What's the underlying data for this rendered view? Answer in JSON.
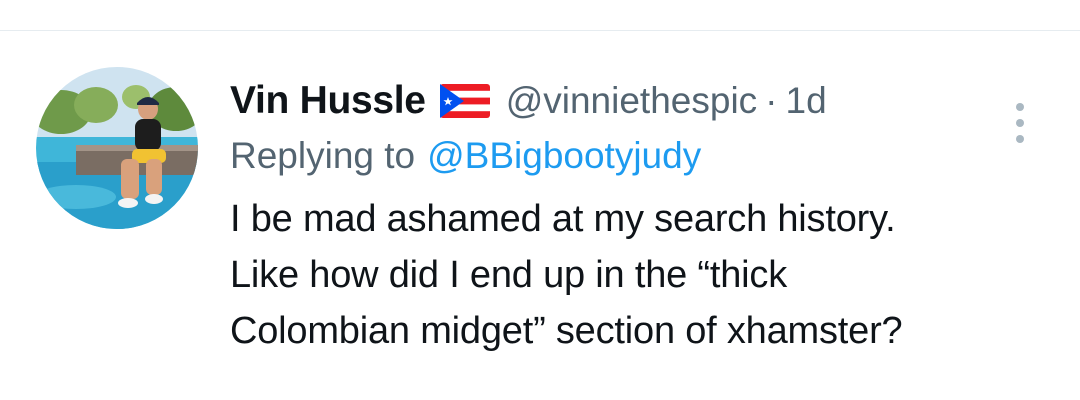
{
  "tweet": {
    "display_name": "Vin Hussle",
    "flag_icon": "puerto-rico-flag-icon",
    "handle": "@vinniethespic",
    "separator": "·",
    "time": "1d",
    "replying_prefix": "Replying to",
    "replying_to": "@BBigbootyjudy",
    "text_lines": [
      "I be mad ashamed at my search history.",
      "Like how did I end up in the “thick",
      "Colombian midget” section of xhamster?"
    ],
    "more_icon": "more-vertical-icon"
  },
  "colors": {
    "name": "#0f1419",
    "secondary": "#536471",
    "link": "#1d9bf0",
    "divider": "#e6ecf0"
  }
}
